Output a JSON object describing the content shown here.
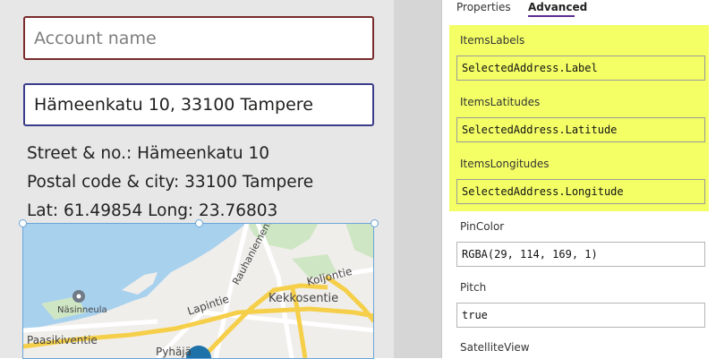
{
  "form": {
    "account_placeholder": "Account name",
    "address_value": "Hämeenkatu 10, 33100 Tampere",
    "street_line": "Street & no.: Hämeenkatu 10",
    "postal_line": "Postal code & city: 33100 Tampere",
    "latlong_line": "Lat: 61.49854 Long: 23.76803"
  },
  "map": {
    "labels": {
      "nasinneula": "Näsinneula",
      "paasikiventie": "Paasikiventie",
      "pyhaja": "Pyhäjä",
      "lapintie": "Lapintie",
      "kekkosentie": "Kekkosentie",
      "koljontie": "Koljontie",
      "rauhaniementie": "Rauhaniementie"
    }
  },
  "panel": {
    "tabs": [
      "Properties",
      "Advanced"
    ],
    "active_tab": "Advanced",
    "props": [
      {
        "label": "ItemsLabels",
        "value": "SelectedAddress.Label"
      },
      {
        "label": "ItemsLatitudes",
        "value": "SelectedAddress.Latitude"
      },
      {
        "label": "ItemsLongitudes",
        "value": "SelectedAddress.Longitude"
      },
      {
        "label": "PinColor",
        "value": "RGBA(29, 114, 169, 1)"
      },
      {
        "label": "Pitch",
        "value": "true"
      },
      {
        "label": "SatelliteView",
        "value": ""
      }
    ]
  },
  "colors": {
    "highlight": "#f4ff66",
    "tab_accent": "#5b2d90",
    "pin": "#1d72a9",
    "water": "#a8d1ee",
    "land": "#f0eeea",
    "park": "#cfe6c5",
    "major_road": "#f6cf4a"
  }
}
